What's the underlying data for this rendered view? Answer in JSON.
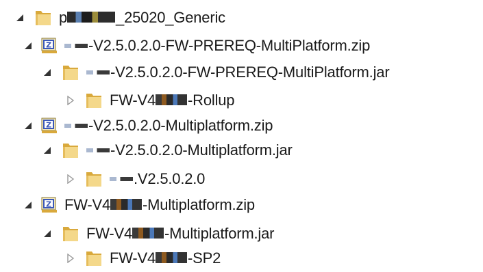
{
  "tree": {
    "rows": [
      {
        "toggle": "expanded",
        "icon": "folder",
        "prefix": "p",
        "text": "_25020_Generic",
        "redaction": "a"
      },
      {
        "toggle": "expanded",
        "icon": "zip",
        "prefix": "",
        "text": "-V2.5.0.2.0-FW-PREREQ-MultiPlatform.zip",
        "redaction": "b"
      },
      {
        "toggle": "expanded",
        "icon": "folder",
        "prefix": "",
        "text": "-V2.5.0.2.0-FW-PREREQ-MultiPlatform.jar",
        "redaction": "b"
      },
      {
        "toggle": "collapsed",
        "icon": "folder",
        "prefix": "FW-V4",
        "text": "-Rollup",
        "redaction": "c"
      },
      {
        "toggle": "expanded",
        "icon": "zip",
        "prefix": "",
        "text": "-V2.5.0.2.0-Multiplatform.zip",
        "redaction": "b"
      },
      {
        "toggle": "expanded",
        "icon": "folder",
        "prefix": "",
        "text": "-V2.5.0.2.0-Multiplatform.jar",
        "redaction": "b"
      },
      {
        "toggle": "collapsed",
        "icon": "folder",
        "prefix": "",
        "text": ".V2.5.0.2.0",
        "redaction": "b"
      },
      {
        "toggle": "expanded",
        "icon": "zip",
        "prefix": "FW-V4",
        "text": "-Multiplatform.zip",
        "redaction": "c"
      },
      {
        "toggle": "expanded",
        "icon": "folder",
        "prefix": "FW-V4",
        "text": "-Multiplatform.jar",
        "redaction": "c"
      },
      {
        "toggle": "collapsed",
        "icon": "folder",
        "prefix": "FW-V4",
        "text": "-SP2",
        "redaction": "c"
      }
    ]
  },
  "colors": {
    "folder_light": "#f4d88a",
    "folder_dark": "#d9a93c",
    "zip_blue": "#3b58b8",
    "toggle_expanded": "#333333",
    "toggle_collapsed": "#9a9a9a"
  }
}
